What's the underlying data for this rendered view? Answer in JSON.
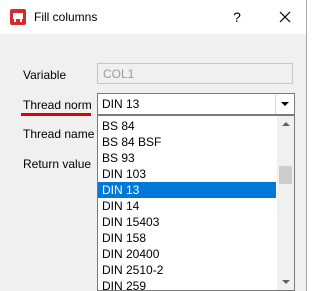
{
  "window": {
    "title": "Fill columns",
    "help_label": "?",
    "icon": "app-logo-icon",
    "close_icon": "close-icon"
  },
  "form": {
    "variable_label": "Variable",
    "variable_value": "COL1",
    "thread_norm_label": "Thread norm",
    "thread_norm_value": "DIN 13",
    "thread_name_label": "Thread name",
    "return_value_label": "Return value"
  },
  "dropdown": {
    "items": [
      "BS 84",
      "BS 84 BSF",
      "BS 93",
      "DIN 103",
      "DIN 13",
      "DIN 14",
      "DIN 15403",
      "DIN 158",
      "DIN 20400",
      "DIN 2510-2",
      "DIN 259"
    ],
    "selected": "DIN 13"
  },
  "colors": {
    "accent": "#0078d7",
    "highlight_underline": "#e00000",
    "app_icon": "#d62b2b"
  }
}
